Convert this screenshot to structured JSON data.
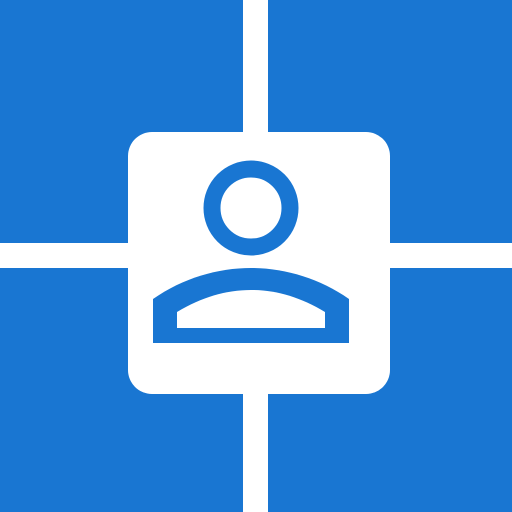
{
  "icon": {
    "name": "user-account-tiles-app-icon",
    "glyph": "person-icon",
    "colors": {
      "accent": "#1976d2",
      "background": "#ffffff"
    }
  }
}
